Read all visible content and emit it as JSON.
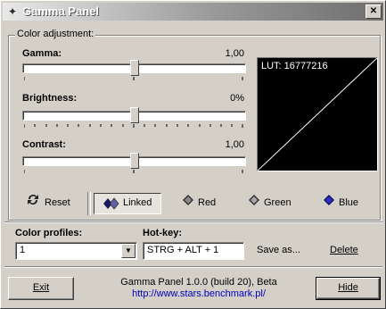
{
  "window": {
    "title": "Gamma Panel",
    "close_glyph": "✕"
  },
  "group": {
    "label": "Color adjustment:"
  },
  "sliders": [
    {
      "label": "Gamma:",
      "value_text": "1,00",
      "position": 0.5
    },
    {
      "label": "Brightness:",
      "value_text": "0%",
      "position": 0.5
    },
    {
      "label": "Contrast:",
      "value_text": "1,00",
      "position": 0.5
    }
  ],
  "lut": {
    "label": "LUT: 16777216"
  },
  "toolbar": {
    "reset": "Reset",
    "linked": "Linked",
    "red": "Red",
    "green": "Green",
    "blue": "Blue"
  },
  "profiles": {
    "label": "Color profiles:",
    "value": "1"
  },
  "hotkey": {
    "label": "Hot-key:",
    "value": "STRG + ALT + 1"
  },
  "actions": {
    "save_as": "Save as...",
    "delete": "Delete"
  },
  "footer": {
    "exit": "Exit",
    "version": "Gamma Panel 1.0.0 (build 20), Beta",
    "url": "http://www.stars.benchmark.pl/",
    "hide": "Hide"
  },
  "colors": {
    "red": "#c00000",
    "green": "#6a8f3a",
    "blue": "#1010a0",
    "link": "#0000c0"
  }
}
